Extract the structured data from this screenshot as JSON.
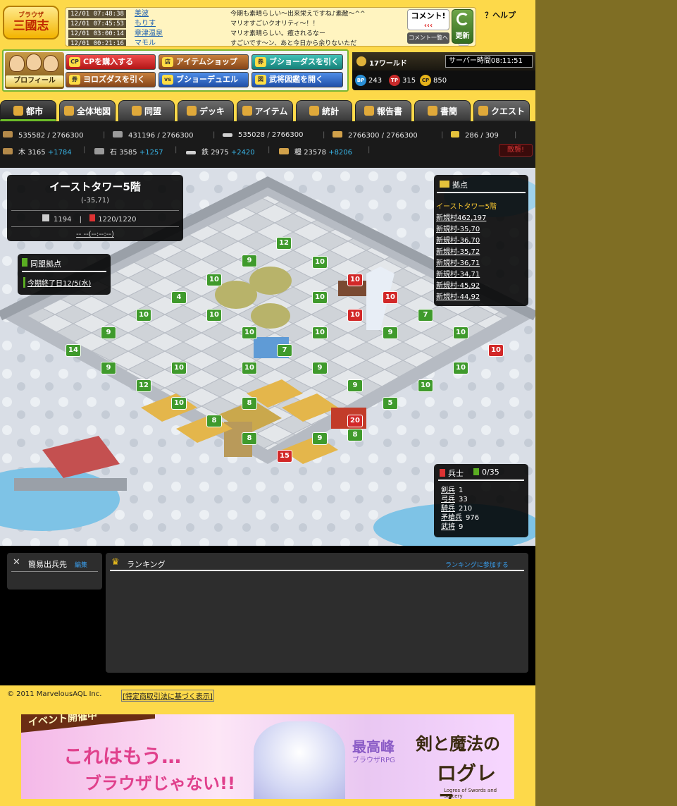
{
  "header": {
    "logo_top": "ブラウザ",
    "logo_main": "三國志",
    "feed": [
      {
        "time": "12/01 07:48:38",
        "name": "美波",
        "msg": "今期も素晴らしい〜出来栄えですね♪素敵〜^^"
      },
      {
        "time": "12/01 07:45:53",
        "name": "もりす",
        "msg": "マリオすごいクオリティ〜！！"
      },
      {
        "time": "12/01 03:00:14",
        "name": "章津温泉",
        "msg": "マリオ素晴らしい。癒されるなー"
      },
      {
        "time": "12/01 00:21:16",
        "name": "マモル",
        "msg": "すごいです〜ン、あと今日から余りないただ"
      }
    ],
    "comment_label": "コメント!",
    "comment_arrows": "‹‹‹",
    "comment_list": "コメント一覧へ",
    "refresh_label": "更新",
    "help_label": "？ヘルプ"
  },
  "hero": {
    "profile_label": "プロフィール",
    "buttons": [
      {
        "label": "CPを購入する",
        "icon": "CP"
      },
      {
        "label": "アイテムショップ",
        "icon": "店"
      },
      {
        "label": "ブショーダスを引く",
        "icon": "券"
      },
      {
        "label": "ヨロズダスを引く",
        "icon": "券"
      },
      {
        "label": "ブショーデュエル",
        "icon": "vs"
      },
      {
        "label": "武将図鑑を開く",
        "icon": "図"
      }
    ]
  },
  "world": {
    "name": "17ワールド",
    "server_time": "サーバー時間08:11:51",
    "bp_icon": "BP",
    "bp": "243",
    "tp_icon": "TP",
    "tp": "315",
    "cp_icon": "CP",
    "cp": "850"
  },
  "nav": {
    "tabs": [
      "都市",
      "全体地図",
      "同盟",
      "デッキ",
      "アイテム",
      "統計",
      "報告書",
      "書簡",
      "クエスト"
    ]
  },
  "resources": {
    "row1": [
      {
        "value": "535582 / 2766300"
      },
      {
        "value": "431196 / 2766300"
      },
      {
        "value": "535028 / 2766300"
      },
      {
        "value": "2766300 / 2766300"
      },
      {
        "value": "286 / 309"
      }
    ],
    "row2": [
      {
        "name": "木",
        "value": "3165",
        "rate": "+1784"
      },
      {
        "name": "石",
        "value": "3585",
        "rate": "+1257"
      },
      {
        "name": "鉄",
        "value": "2975",
        "rate": "+2420"
      },
      {
        "name": "糧",
        "value": "23578",
        "rate": "+8206"
      }
    ],
    "alert_label": "敵襲!"
  },
  "city": {
    "name": "イーストタワー5階",
    "coord": "(-35,71)",
    "population": "1194",
    "soldiers": "1220/1220",
    "timer": "-- --(--:--:--)"
  },
  "alliance": {
    "title": "同盟拠点",
    "link": "今期終了日12/5(水)"
  },
  "bases": {
    "title": "拠点",
    "current": "イーストタワー5階",
    "items": [
      "新規村462,197",
      "新規村-35,70",
      "新規村-36,70",
      "新規村-35,72",
      "新規村-36,71",
      "新規村-34,71",
      "新規村-45,92",
      "新規村-44,92"
    ]
  },
  "soldiers": {
    "title": "兵士",
    "count": "0/35",
    "items": [
      {
        "name": "剣兵",
        "count": "1"
      },
      {
        "name": "弓兵",
        "count": "33"
      },
      {
        "name": "騎兵",
        "count": "210"
      },
      {
        "name": "矛槍兵",
        "count": "976"
      },
      {
        "name": "武将",
        "count": "9"
      }
    ]
  },
  "map_levels": [
    {
      "v": "12",
      "t": "g"
    },
    {
      "v": "9",
      "t": "g"
    },
    {
      "v": "10",
      "t": "g"
    },
    {
      "v": "10",
      "t": "g"
    },
    {
      "v": "10",
      "t": "r"
    },
    {
      "v": "4",
      "t": "g"
    },
    {
      "v": "10",
      "t": "g"
    },
    {
      "v": "10",
      "t": "g"
    },
    {
      "v": "10",
      "t": "r"
    },
    {
      "v": "10",
      "t": "g"
    },
    {
      "v": "10",
      "t": "r"
    },
    {
      "v": "7",
      "t": "g"
    },
    {
      "v": "10",
      "t": "g"
    },
    {
      "v": "9",
      "t": "g"
    },
    {
      "v": "10",
      "t": "g"
    },
    {
      "v": "10",
      "t": "g"
    },
    {
      "v": "9",
      "t": "g"
    },
    {
      "v": "10",
      "t": "g"
    },
    {
      "v": "14",
      "t": "g"
    },
    {
      "v": "7",
      "t": "g"
    },
    {
      "v": "10",
      "t": "r"
    },
    {
      "v": "9",
      "t": "g"
    },
    {
      "v": "10",
      "t": "g"
    },
    {
      "v": "9",
      "t": "g"
    },
    {
      "v": "10",
      "t": "g"
    },
    {
      "v": "10",
      "t": "g"
    },
    {
      "v": "12",
      "t": "g"
    },
    {
      "v": "9",
      "t": "g"
    },
    {
      "v": "10",
      "t": "g"
    },
    {
      "v": "8",
      "t": "g"
    },
    {
      "v": "8",
      "t": "g"
    },
    {
      "v": "5",
      "t": "g"
    },
    {
      "v": "8",
      "t": "g"
    },
    {
      "v": "20",
      "t": "r"
    },
    {
      "v": "8",
      "t": "g"
    },
    {
      "v": "9",
      "t": "g"
    },
    {
      "v": "15",
      "t": "r"
    }
  ],
  "send": {
    "title": "簡易出兵先",
    "edit": "編集"
  },
  "ranking": {
    "title": "ランキング",
    "join": "ランキングに参加する"
  },
  "footer": {
    "copyright": "© 2011 MarvelousAQL Inc.",
    "legal": "[特定商取引法に基づく表示]"
  },
  "banner": {
    "tag": "イベント開催中",
    "line1": "これはもう…",
    "line2": "ブラウザじゃない!!",
    "sub": "最高峰",
    "sub2": "ブラウザRPG",
    "title": "剣と魔法の",
    "title2": "ログレス",
    "title3": "Logres of Swords and Sorcery"
  },
  "colors": {
    "page": "#fdd94a",
    "side": "#7f6e24",
    "accent": "#6cbd28",
    "link": "#3aa0f0",
    "gain": "#39b6e8"
  }
}
